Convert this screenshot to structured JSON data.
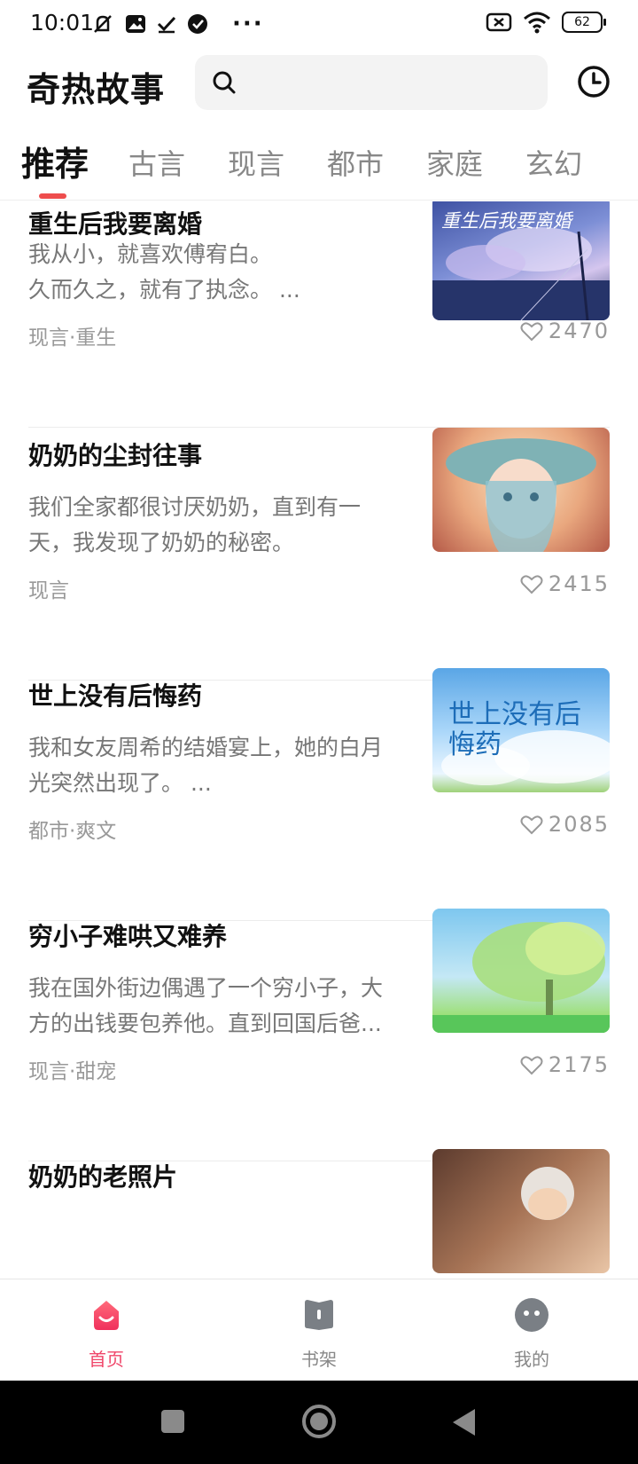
{
  "status_bar": {
    "time": "10:01",
    "battery": "62",
    "more": "···",
    "icons": [
      "mute-icon",
      "image-icon",
      "check-icon",
      "verified-icon",
      "sim-x-icon",
      "wifi-icon",
      "battery-icon"
    ]
  },
  "header": {
    "app_title": "奇热故事",
    "search_placeholder": "",
    "icons": [
      "search-icon",
      "history-icon"
    ]
  },
  "tabs": [
    {
      "label": "推荐",
      "active": true
    },
    {
      "label": "古言"
    },
    {
      "label": "现言"
    },
    {
      "label": "都市"
    },
    {
      "label": "家庭"
    },
    {
      "label": "玄幻"
    }
  ],
  "stories": [
    {
      "title": "重生后我要离婚",
      "desc": "我从小，就喜欢傅宥白。\n久而久之，就有了执念。 ...",
      "tag": "现言·重生",
      "likes": "2470",
      "cover": {
        "text": "重生后我要离婚",
        "colors": [
          "#2b3f86",
          "#6c82c9",
          "#c9b9e6"
        ]
      }
    },
    {
      "title": "奶奶的尘封往事",
      "desc": "我们全家都很讨厌奶奶，直到有一天，我发现了奶奶的秘密。",
      "tag": "现言",
      "likes": "2415",
      "cover": {
        "colors": [
          "#f3c99a",
          "#d98a66",
          "#7fa6b8"
        ]
      }
    },
    {
      "title": "世上没有后悔药",
      "desc": "我和女友周希的结婚宴上，她的白月光突然出现了。 ...",
      "tag": "都市·爽文",
      "likes": "2085",
      "cover": {
        "text": "世上没有后悔药",
        "colors": [
          "#6fb3ea",
          "#bfe1fb",
          "#e8f4ff"
        ]
      }
    },
    {
      "title": "穷小子难哄又难养",
      "desc": "我在国外街边偶遇了一个穷小子，大方的出钱要包养他。直到回国后爸...",
      "tag": "现言·甜宠",
      "likes": "2175",
      "cover": {
        "colors": [
          "#8ed0ef",
          "#c8ec9a",
          "#5bc46a"
        ]
      }
    },
    {
      "title": "奶奶的老照片",
      "desc": "",
      "tag": "",
      "likes": "",
      "cover": {
        "colors": [
          "#6b4a3a",
          "#c99a7a",
          "#efd2b8"
        ]
      }
    }
  ],
  "bottom_nav": [
    {
      "label": "首页",
      "active": true,
      "icon": "home-icon"
    },
    {
      "label": "书架",
      "icon": "bookshelf-icon"
    },
    {
      "label": "我的",
      "icon": "profile-icon"
    }
  ],
  "colors": {
    "accent": "#ee4d4d",
    "nav_active": "#f0466a",
    "text_muted": "#999999"
  }
}
